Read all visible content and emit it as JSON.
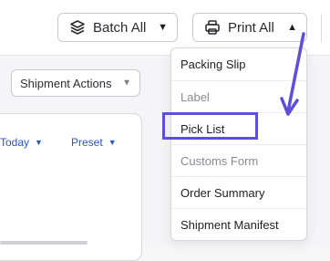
{
  "toolbar": {
    "batch_all_label": "Batch All",
    "print_all_label": "Print All"
  },
  "shipment": {
    "actions_label": "Shipment Actions"
  },
  "filters": {
    "today_label": "Today",
    "preset_label": "Preset"
  },
  "print_menu": {
    "items": [
      {
        "label": "Packing Slip",
        "enabled": true
      },
      {
        "label": "Label",
        "enabled": false
      },
      {
        "label": "Pick List",
        "enabled": true
      },
      {
        "label": "Customs Form",
        "enabled": false
      },
      {
        "label": "Order Summary",
        "enabled": true
      },
      {
        "label": "Shipment Manifest",
        "enabled": true
      }
    ]
  },
  "icons": {
    "batch_icon": "layers-icon",
    "print_icon": "printer-icon",
    "caret_icon": "caret-down-icon",
    "caret_up_icon": "caret-up-icon"
  },
  "annotation": {
    "highlight_color": "#5d4fdc",
    "arrow_color": "#5d4fdc"
  }
}
